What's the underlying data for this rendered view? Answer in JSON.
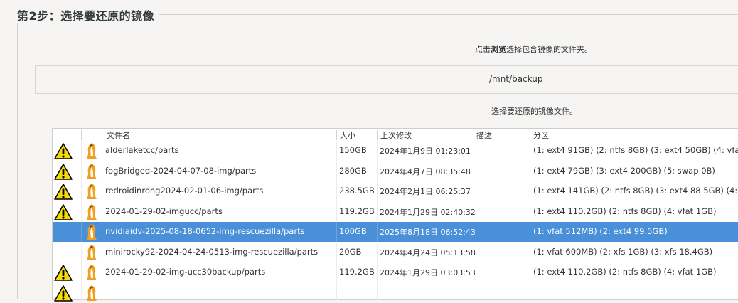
{
  "section_title": "第2步：选择要还原的镜像",
  "instruction_browse": {
    "prefix": "点击",
    "bold": "浏览",
    "suffix": "选择包含镜像的文件夹。"
  },
  "path": "/mnt/backup",
  "instruction_select": "选择要还原的镜像文件。",
  "table": {
    "headers": {
      "name": "文件名",
      "size": "大小",
      "modified": "上次修改",
      "description": "描述",
      "partitions": "分区"
    },
    "rows": [
      {
        "warning": true,
        "icon": "clonezilla-penguin-icon",
        "name": "alderlaketcc/parts",
        "size": "150GB",
        "modified": "2024年1月9日 01:23:01",
        "description": "",
        "partitions": "(1: ext4 91GB) (2: ntfs 8GB) (3: ext4 50GB) (4: vfat",
        "selected": false
      },
      {
        "warning": true,
        "icon": "clonezilla-penguin-icon",
        "name": "fogBridged-2024-04-07-08-img/parts",
        "size": "280GB",
        "modified": "2024年4月7日 08:35:48",
        "description": "",
        "partitions": "(1: ext4 79GB) (3: ext4 200GB) (5: swap 0B)",
        "selected": false
      },
      {
        "warning": true,
        "icon": "clonezilla-penguin-icon",
        "name": "redroidinrong2024-02-01-06-img/parts",
        "size": "238.5GB",
        "modified": "2024年2月1日 06:25:37",
        "description": "",
        "partitions": "(1: ext4 141GB) (2: ntfs 8GB) (3: ext4 88.5GB) (4: v",
        "selected": false
      },
      {
        "warning": true,
        "icon": "clonezilla-penguin-icon",
        "name": "2024-01-29-02-imgucc/parts",
        "size": "119.2GB",
        "modified": "2024年1月29日 02:40:32",
        "description": "",
        "partitions": "(1: ext4 110.2GB) (2: ntfs 8GB) (4: vfat 1GB)",
        "selected": false
      },
      {
        "warning": false,
        "icon": "clonezilla-penguin-icon",
        "name": "nvidiaidv-2025-08-18-0652-img-rescuezilla/parts",
        "size": "100GB",
        "modified": "2025年8月18日 06:52:43",
        "description": "",
        "partitions": "(1: vfat 512MB) (2: ext4 99.5GB)",
        "selected": true
      },
      {
        "warning": false,
        "icon": "clonezilla-penguin-icon",
        "name": "minirocky92-2024-04-24-0513-img-rescuezilla/parts",
        "size": "20GB",
        "modified": "2024年4月24日 05:13:58",
        "description": "",
        "partitions": "(1: vfat 600MB) (2: xfs 1GB) (3: xfs 18.4GB)",
        "selected": false
      },
      {
        "warning": true,
        "icon": "clonezilla-penguin-icon",
        "name": "2024-01-29-02-img-ucc30backup/parts",
        "size": "119.2GB",
        "modified": "2024年1月29日 03:03:53",
        "description": "",
        "partitions": "(1: ext4 110.2GB) (2: ntfs 8GB) (4: vfat 1GB)",
        "selected": false
      },
      {
        "warning": true,
        "icon": "clonezilla-penguin-icon",
        "name": "",
        "size": "",
        "modified": "",
        "description": "",
        "partitions": "",
        "selected": false
      }
    ]
  },
  "colors": {
    "selection": "#4a90d9",
    "warning_yellow": "#f5d90a",
    "penguin_orange": "#f0a020",
    "background": "#f6f5f4"
  }
}
